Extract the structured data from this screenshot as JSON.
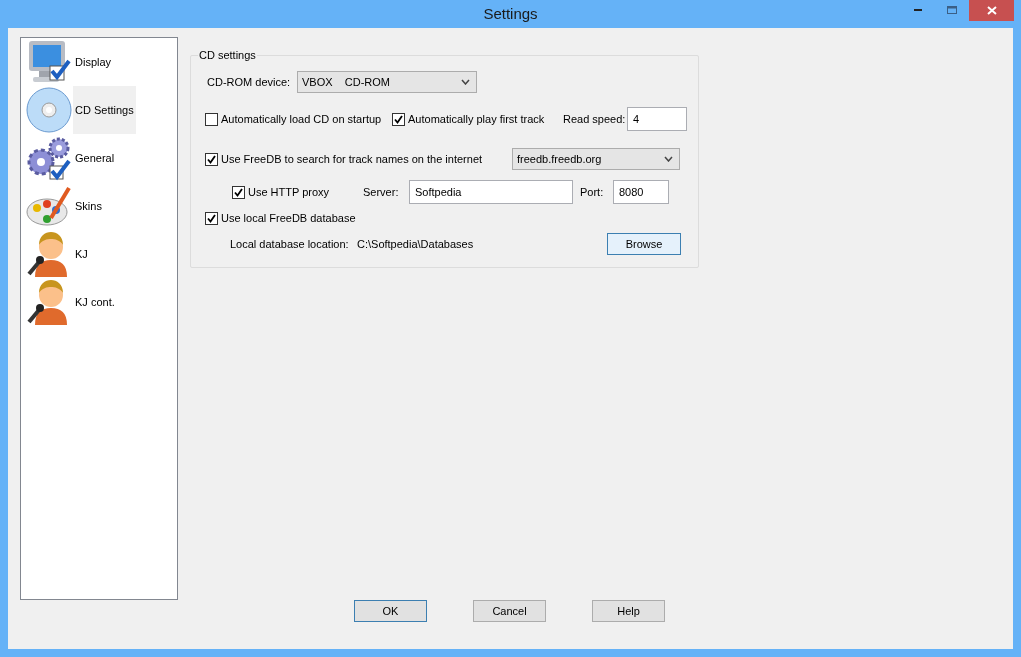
{
  "window": {
    "title": "Settings"
  },
  "sidebar": {
    "items": [
      {
        "label": "Display",
        "selected": false
      },
      {
        "label": "CD Settings",
        "selected": true
      },
      {
        "label": "General",
        "selected": false
      },
      {
        "label": "Skins",
        "selected": false
      },
      {
        "label": "KJ",
        "selected": false
      },
      {
        "label": "KJ cont.",
        "selected": false
      }
    ]
  },
  "group": {
    "title": "CD settings",
    "cdrom_label": "CD-ROM device:",
    "cdrom_value": "VBOX    CD-ROM",
    "auto_load": {
      "label": "Automatically load CD on startup",
      "checked": false
    },
    "auto_play": {
      "label": "Automatically play first track",
      "checked": true
    },
    "read_speed_label": "Read speed:",
    "read_speed": "4",
    "use_freedb": {
      "label": "Use FreeDB to search for track names on the internet",
      "checked": true
    },
    "freedb_server": "freedb.freedb.org",
    "use_proxy": {
      "label": "Use HTTP proxy",
      "checked": true
    },
    "server_label": "Server:",
    "server": "Softpedia",
    "port_label": "Port:",
    "port": "8080",
    "use_local": {
      "label": "Use local FreeDB database",
      "checked": true
    },
    "location_label": "Local database location:",
    "location": "C:\\Softpedia\\Databases",
    "browse": "Browse"
  },
  "buttons": [
    "OK",
    "Cancel",
    "Help"
  ]
}
